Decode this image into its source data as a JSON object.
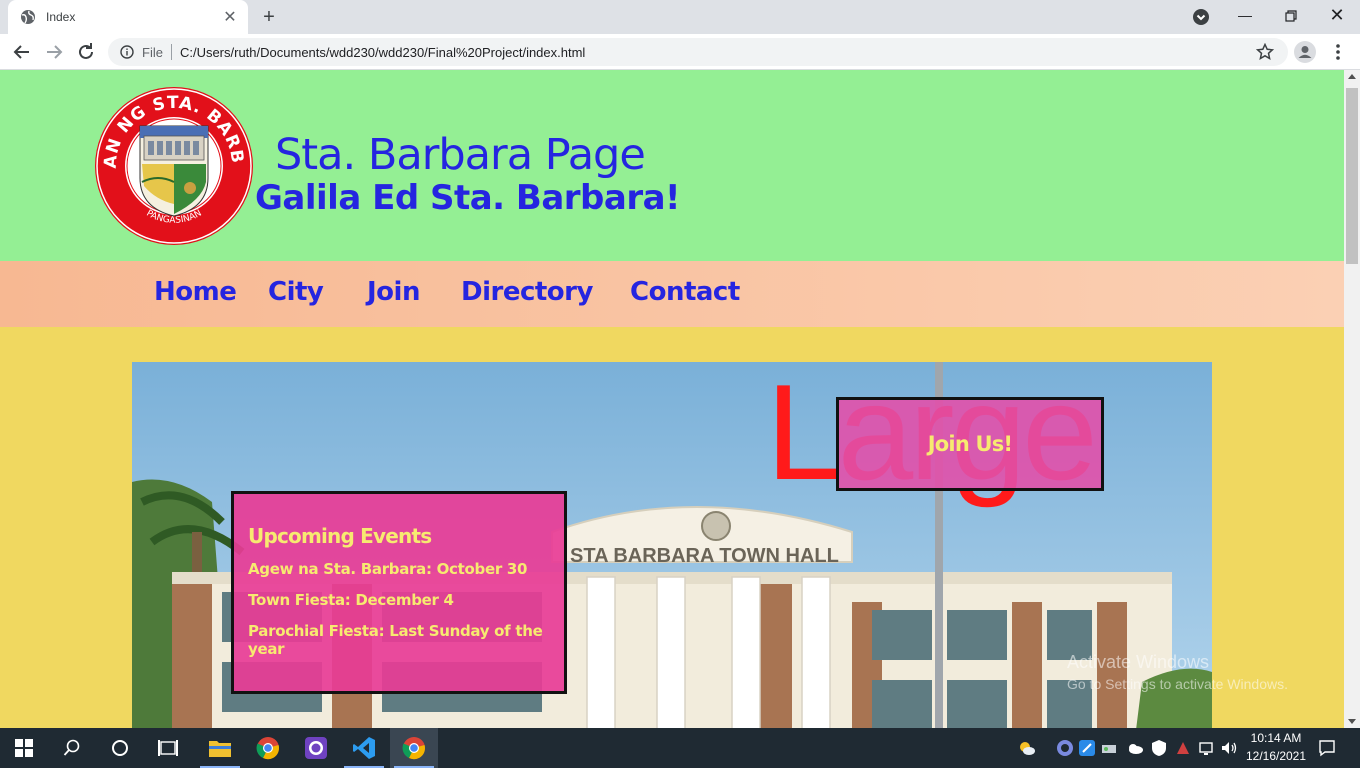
{
  "browser": {
    "tab_title": "Index",
    "new_tab_symbol": "+",
    "close_symbol": "✕",
    "scheme_label": "File",
    "url": "C:/Users/ruth/Documents/wdd230/wdd230/Final%20Project/index.html"
  },
  "site": {
    "title": "Sta. Barbara Page",
    "subtitle": "Galila Ed Sta. Barbara!",
    "seal_text_top": "BAYAN NG STA. BARBARA",
    "seal_text_bottom": "PANGASINAN"
  },
  "nav": {
    "items": [
      {
        "label": "Home"
      },
      {
        "label": "City"
      },
      {
        "label": "Join"
      },
      {
        "label": "Directory"
      },
      {
        "label": "Contact"
      }
    ]
  },
  "hero": {
    "building_sign": "STA BARBARA TOWN HALL",
    "large_text": "Large",
    "join_label": "Join Us!",
    "events": {
      "heading": "Upcoming Events",
      "items": [
        {
          "text": "Agew na Sta. Barbara: October 30"
        },
        {
          "text": "Town Fiesta: December 4"
        },
        {
          "text": "Parochial Fiesta: Last Sunday of the year"
        }
      ]
    }
  },
  "watermark": {
    "line1": "Activate Windows",
    "line2": "Go to Settings to activate Windows."
  },
  "taskbar": {
    "time": "10:14 AM",
    "date": "12/16/2021"
  },
  "colors": {
    "header_bg": "#94ef94",
    "nav_bg": "#f7b892",
    "page_bg": "#f0d860",
    "link_blue": "#2525e0",
    "accent_pink": "#e83c96",
    "accent_yellow": "#f7ea70",
    "large_red": "#ff1a1a"
  }
}
